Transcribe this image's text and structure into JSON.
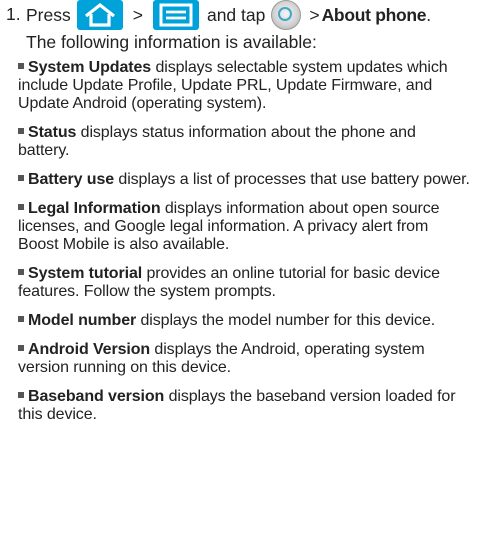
{
  "step": {
    "number": "1.",
    "press": "Press",
    "gt1": ">",
    "and_tap": "and tap",
    "gt2": ">",
    "about_phone": "About phone",
    "period": ".",
    "intro": "The following information is available:"
  },
  "icons": {
    "home": "home-icon",
    "menu": "menu-icon",
    "settings": "settings-icon",
    "accent": "#00a3d9"
  },
  "items": [
    {
      "term": "System Updates",
      "desc": " displays selectable system updates which include Update Profile, Update PRL, Update Firmware, and Update Android (operating system)."
    },
    {
      "term": "Status",
      "desc": " displays status information about the phone and battery."
    },
    {
      "term": "Battery use",
      "desc": " displays a list of processes that use battery power."
    },
    {
      "term": "Legal Information",
      "desc": " displays information about open source licenses, and Google legal information. A privacy alert from Boost Mobile is also available."
    },
    {
      "term": "System tutorial",
      "desc": " provides an online tutorial for basic device features. Follow the system prompts."
    },
    {
      "term": "Model number",
      "desc": " displays the model number for this device."
    },
    {
      "term": "Android Version",
      "desc": " displays the Android, operating system version running on this device."
    },
    {
      "term": "Baseband version",
      "desc": " displays the baseband version loaded for this device."
    }
  ]
}
